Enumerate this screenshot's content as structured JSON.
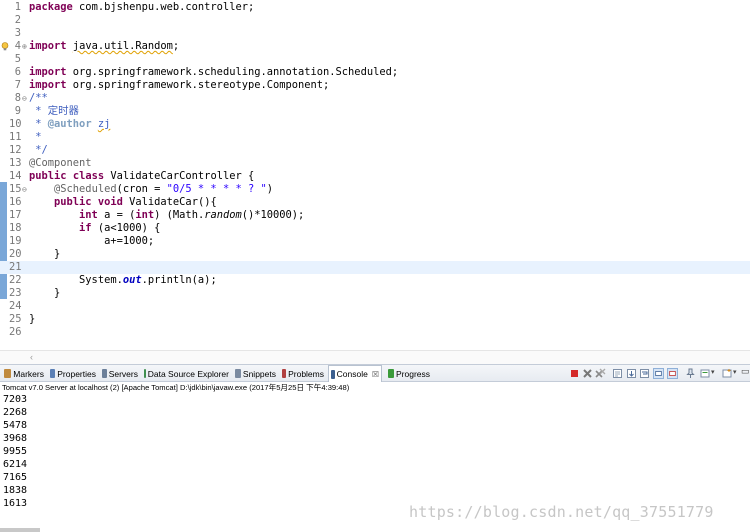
{
  "editor": {
    "lines": [
      {
        "n": "1",
        "segs": [
          {
            "t": "package",
            "c": "kw"
          },
          {
            "t": " com.bjshenpu.web.controller;"
          }
        ]
      },
      {
        "n": "2",
        "segs": []
      },
      {
        "n": "3",
        "segs": []
      },
      {
        "n": "4",
        "fold": "⊕",
        "warn": true,
        "segs": [
          {
            "t": "import",
            "c": "kw"
          },
          {
            "t": " "
          },
          {
            "t": "java.util.Random",
            "c": "squig"
          },
          {
            "t": ";"
          }
        ]
      },
      {
        "n": "5",
        "segs": []
      },
      {
        "n": "6",
        "segs": [
          {
            "t": "import",
            "c": "kw"
          },
          {
            "t": " org.springframework.scheduling.annotation.Scheduled;"
          }
        ]
      },
      {
        "n": "7",
        "segs": [
          {
            "t": "import",
            "c": "kw"
          },
          {
            "t": " org.springframework.stereotype.Component;"
          }
        ]
      },
      {
        "n": "8",
        "fold": "⊖",
        "segs": [
          {
            "t": "/**",
            "c": "cmt"
          }
        ]
      },
      {
        "n": "9",
        "segs": [
          {
            "t": " * 定时器",
            "c": "cmt"
          }
        ]
      },
      {
        "n": "10",
        "segs": [
          {
            "t": " * ",
            "c": "cmt"
          },
          {
            "t": "@author",
            "c": "tag"
          },
          {
            "t": " ",
            "c": "cmt"
          },
          {
            "t": "zj",
            "c": "cmt squig"
          }
        ]
      },
      {
        "n": "11",
        "segs": [
          {
            "t": " *",
            "c": "cmt"
          }
        ]
      },
      {
        "n": "12",
        "segs": [
          {
            "t": " */",
            "c": "cmt"
          }
        ]
      },
      {
        "n": "13",
        "segs": [
          {
            "t": "@Component",
            "c": "ann"
          }
        ]
      },
      {
        "n": "14",
        "segs": [
          {
            "t": "public",
            "c": "kw"
          },
          {
            "t": " "
          },
          {
            "t": "class",
            "c": "kw"
          },
          {
            "t": " ValidateCarController {"
          }
        ]
      },
      {
        "n": "15",
        "fold": "⊖",
        "segs": [
          {
            "t": "    "
          },
          {
            "t": "@Scheduled",
            "c": "ann"
          },
          {
            "t": "(cron = "
          },
          {
            "t": "\"0/5 * * * * ? \"",
            "c": "str"
          },
          {
            "t": ")"
          }
        ]
      },
      {
        "n": "16",
        "segs": [
          {
            "t": "    "
          },
          {
            "t": "public",
            "c": "kw"
          },
          {
            "t": " "
          },
          {
            "t": "void",
            "c": "kw"
          },
          {
            "t": " ValidateCar(){"
          }
        ]
      },
      {
        "n": "17",
        "segs": [
          {
            "t": "        "
          },
          {
            "t": "int",
            "c": "kw"
          },
          {
            "t": " a = ("
          },
          {
            "t": "int",
            "c": "kw"
          },
          {
            "t": ") (Math."
          },
          {
            "t": "random",
            "c": "it"
          },
          {
            "t": "()*10000);"
          }
        ]
      },
      {
        "n": "18",
        "segs": [
          {
            "t": "        "
          },
          {
            "t": "if",
            "c": "kw"
          },
          {
            "t": " (a<1000) {"
          }
        ]
      },
      {
        "n": "19",
        "segs": [
          {
            "t": "            a+=1000;"
          }
        ]
      },
      {
        "n": "20",
        "segs": [
          {
            "t": "    }"
          }
        ]
      },
      {
        "n": "21",
        "current": true,
        "segs": []
      },
      {
        "n": "22",
        "segs": [
          {
            "t": "        System."
          },
          {
            "t": "out",
            "c": "fld"
          },
          {
            "t": ".println(a);"
          }
        ]
      },
      {
        "n": "23",
        "segs": [
          {
            "t": "    }"
          }
        ]
      },
      {
        "n": "24",
        "segs": []
      },
      {
        "n": "25",
        "segs": [
          {
            "t": "}"
          }
        ]
      },
      {
        "n": "26",
        "segs": []
      }
    ]
  },
  "views": {
    "tabs": [
      {
        "label": "Markers",
        "icon": "markers-icon",
        "color": "#c08a3e"
      },
      {
        "label": "Properties",
        "icon": "properties-icon",
        "color": "#5a7fb5"
      },
      {
        "label": "Servers",
        "icon": "servers-icon",
        "color": "#6b7f99"
      },
      {
        "label": "Data Source Explorer",
        "icon": "database-icon",
        "color": "#3f8f4f"
      },
      {
        "label": "Snippets",
        "icon": "snippets-icon",
        "color": "#7a8aa0"
      },
      {
        "label": "Problems",
        "icon": "problems-icon",
        "color": "#b04040"
      },
      {
        "label": "Console",
        "icon": "console-icon",
        "color": "#3c5f8f",
        "active": true,
        "close": "☒"
      },
      {
        "label": "Progress",
        "icon": "progress-icon",
        "color": "#3a9a3a"
      }
    ]
  },
  "console": {
    "title": "Tomcat v7.0 Server at localhost (2) [Apache Tomcat] D:\\jdk\\bin\\javaw.exe (2017年5月25日 下午4:39:48)",
    "output": [
      "7203",
      "2268",
      "5478",
      "3968",
      "9955",
      "6214",
      "7165",
      "1838",
      "1613"
    ]
  },
  "watermark": "https://blog.csdn.net/qq_37551779"
}
